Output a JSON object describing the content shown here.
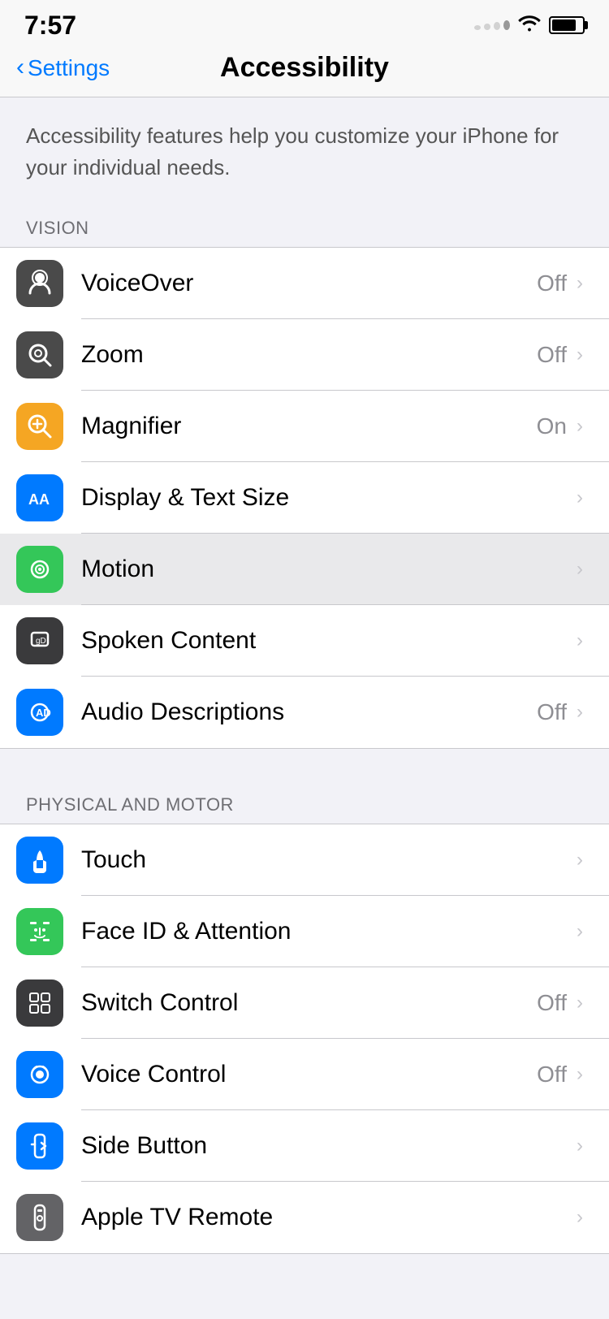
{
  "statusBar": {
    "time": "7:57",
    "signal": "dots",
    "wifi": "wifi",
    "battery": "battery"
  },
  "header": {
    "backLabel": "Settings",
    "title": "Accessibility"
  },
  "description": "Accessibility features help you customize your iPhone for your individual needs.",
  "sections": [
    {
      "label": "VISION",
      "items": [
        {
          "name": "VoiceOver",
          "value": "Off",
          "hasChevron": true,
          "iconBg": "#4a4a4a",
          "iconType": "voiceover"
        },
        {
          "name": "Zoom",
          "value": "Off",
          "hasChevron": true,
          "iconBg": "#4a4a4a",
          "iconType": "zoom"
        },
        {
          "name": "Magnifier",
          "value": "On",
          "hasChevron": true,
          "iconBg": "#f5a623",
          "iconType": "magnifier"
        },
        {
          "name": "Display & Text Size",
          "value": "",
          "hasChevron": true,
          "iconBg": "#007aff",
          "iconType": "display"
        },
        {
          "name": "Motion",
          "value": "",
          "hasChevron": true,
          "iconBg": "#34c759",
          "iconType": "motion",
          "highlighted": true
        },
        {
          "name": "Spoken Content",
          "value": "",
          "hasChevron": true,
          "iconBg": "#3a3a3c",
          "iconType": "spoken"
        },
        {
          "name": "Audio Descriptions",
          "value": "Off",
          "hasChevron": true,
          "iconBg": "#007aff",
          "iconType": "audio"
        }
      ]
    },
    {
      "label": "PHYSICAL AND MOTOR",
      "items": [
        {
          "name": "Touch",
          "value": "",
          "hasChevron": true,
          "iconBg": "#007aff",
          "iconType": "touch"
        },
        {
          "name": "Face ID & Attention",
          "value": "",
          "hasChevron": true,
          "iconBg": "#34c759",
          "iconType": "faceid"
        },
        {
          "name": "Switch Control",
          "value": "Off",
          "hasChevron": true,
          "iconBg": "#3a3a3c",
          "iconType": "switch"
        },
        {
          "name": "Voice Control",
          "value": "Off",
          "hasChevron": true,
          "iconBg": "#007aff",
          "iconType": "voicecontrol"
        },
        {
          "name": "Side Button",
          "value": "",
          "hasChevron": true,
          "iconBg": "#007aff",
          "iconType": "sidebutton"
        },
        {
          "name": "Apple TV Remote",
          "value": "",
          "hasChevron": true,
          "iconBg": "#636366",
          "iconType": "appletvremote"
        }
      ]
    }
  ],
  "icons": {
    "voiceover": "#4a4a4a",
    "zoom": "#4a4a4a",
    "magnifier": "#f5a623",
    "display": "#007aff",
    "motion": "#34c759",
    "spoken": "#3a3a3c",
    "audio": "#007aff",
    "touch": "#007aff",
    "faceid": "#34c759",
    "switch": "#3a3a3c",
    "voicecontrol": "#007aff",
    "sidebutton": "#007aff",
    "appletvremote": "#636366"
  }
}
